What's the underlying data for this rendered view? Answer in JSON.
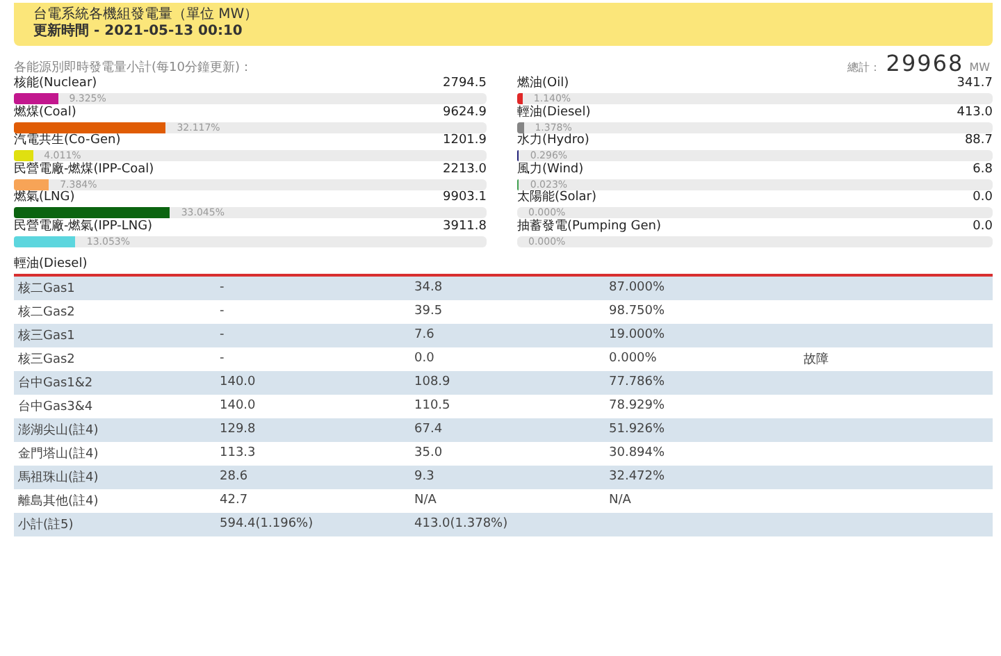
{
  "header": {
    "title": "台電系統各機組發電量（單位 MW）",
    "updated": "更新時間 - 2021-05-13 00:10"
  },
  "summary": {
    "caption": "各能源別即時發電量小計(每10分鐘更新)：",
    "total_label": "總計：",
    "total_value": "29968",
    "total_unit": "MW"
  },
  "sources": [
    {
      "name": "核能(Nuclear)",
      "value": "2794.5",
      "percent": "9.325%",
      "level": 0.09325,
      "color": "#c2178e"
    },
    {
      "name": "燃煤(Coal)",
      "value": "9624.9",
      "percent": "32.117%",
      "level": 0.32117,
      "color": "#e05c05"
    },
    {
      "name": "汽電共生(Co-Gen)",
      "value": "1201.9",
      "percent": "4.011%",
      "level": 0.04011,
      "color": "#e0e010"
    },
    {
      "name": "民營電廠-燃煤(IPP-Coal)",
      "value": "2213.0",
      "percent": "7.384%",
      "level": 0.07384,
      "color": "#f7a457"
    },
    {
      "name": "燃氣(LNG)",
      "value": "9903.1",
      "percent": "33.045%",
      "level": 0.33045,
      "color": "#0b6410"
    },
    {
      "name": "民營電廠-燃氣(IPP-LNG)",
      "value": "3911.8",
      "percent": "13.053%",
      "level": 0.13053,
      "color": "#5cd6de"
    },
    {
      "name": "燃油(Oil)",
      "value": "341.7",
      "percent": "1.140%",
      "level": 0.0114,
      "color": "#e02828"
    },
    {
      "name": "輕油(Diesel)",
      "value": "413.0",
      "percent": "1.378%",
      "level": 0.01378,
      "color": "#858585"
    },
    {
      "name": "水力(Hydro)",
      "value": "88.7",
      "percent": "0.296%",
      "level": 0.00296,
      "color": "#23237a"
    },
    {
      "name": "風力(Wind)",
      "value": "6.8",
      "percent": "0.023%",
      "level": 0.00023,
      "color": "#40a050"
    },
    {
      "name": "太陽能(Solar)",
      "value": "0.0",
      "percent": "0.000%"
    },
    {
      "name": "抽蓄發電(Pumping Gen)",
      "value": "0.0",
      "percent": "0.000%"
    }
  ],
  "table": {
    "title": "輕油(Diesel)",
    "rows": [
      [
        "核二Gas1",
        "-",
        "34.8",
        "87.000%",
        ""
      ],
      [
        "核二Gas2",
        "-",
        "39.5",
        "98.750%",
        ""
      ],
      [
        "核三Gas1",
        "-",
        "7.6",
        "19.000%",
        ""
      ],
      [
        "核三Gas2",
        "-",
        "0.0",
        "0.000%",
        "故障"
      ],
      [
        "台中Gas1&2",
        "140.0",
        "108.9",
        "77.786%",
        ""
      ],
      [
        "台中Gas3&4",
        "140.0",
        "110.5",
        "78.929%",
        ""
      ],
      [
        "澎湖尖山(註4)",
        "129.8",
        "67.4",
        "51.926%",
        ""
      ],
      [
        "金門塔山(註4)",
        "113.3",
        "35.0",
        "30.894%",
        ""
      ],
      [
        "馬祖珠山(註4)",
        "28.6",
        "9.3",
        "32.472%",
        ""
      ],
      [
        "離島其他(註4)",
        "42.7",
        "N/A",
        "N/A",
        ""
      ],
      [
        "小計(註5)",
        "594.4(1.196%)",
        "413.0(1.378%)",
        "",
        ""
      ]
    ]
  }
}
